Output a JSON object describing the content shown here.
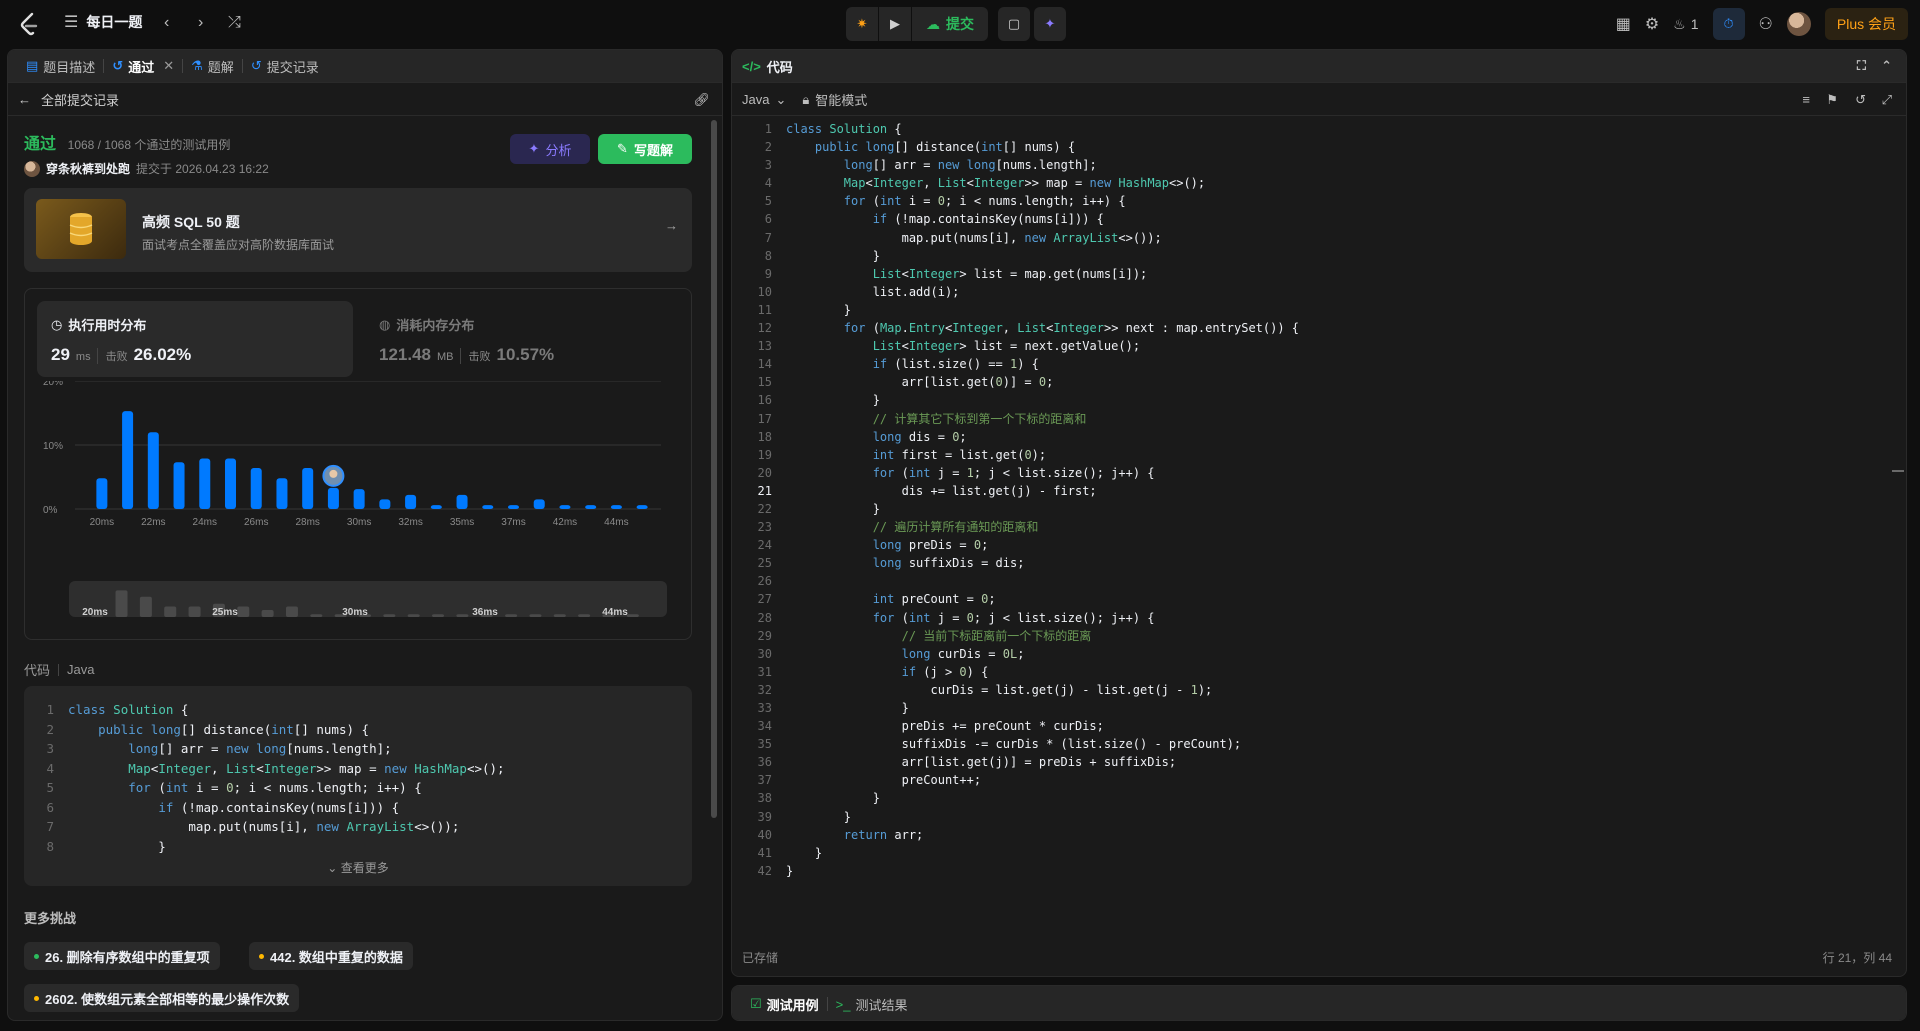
{
  "topbar": {
    "daily_label": "每日一题",
    "submit_label": "提交",
    "streak_count": "1",
    "plus_label": "Plus 会员"
  },
  "left": {
    "tabs": [
      {
        "label": "题目描述"
      },
      {
        "label": "通过"
      },
      {
        "label": "题解"
      },
      {
        "label": "提交记录"
      }
    ],
    "back_label": "全部提交记录",
    "status": "通过",
    "cases": "1068 / 1068 个通过的测试用例",
    "author": "穿条秋裤到处跑",
    "submitted": "提交于 2026.04.23 16:22",
    "analyze_label": "分析",
    "write_label": "写题解",
    "promo": {
      "title": "高频 SQL 50 题",
      "subtitle": "面试考点全覆盖应对高阶数据库面试"
    },
    "runtime": {
      "title": "执行用时分布",
      "value": "29",
      "unit": "ms",
      "beat_label": "击败",
      "beat": "26.02%"
    },
    "memory": {
      "title": "消耗内存分布",
      "value": "121.48",
      "unit": "MB",
      "beat_label": "击败",
      "beat": "10.57%"
    },
    "code_label": "代码",
    "code_lang": "Java",
    "see_more": "查看更多",
    "more_title": "更多挑战",
    "challenges": [
      {
        "label": "26. 删除有序数组中的重复项",
        "color": "#2cbb5d"
      },
      {
        "label": "442. 数组中重复的数据",
        "color": "#ffb800"
      },
      {
        "label": "2602. 使数组元素全部相等的最少操作次数",
        "color": "#ffb800"
      }
    ]
  },
  "chart_data": {
    "type": "bar",
    "title": "执行用时分布",
    "categories": [
      "20ms",
      "21ms",
      "22ms",
      "23ms",
      "24ms",
      "25ms",
      "26ms",
      "27ms",
      "28ms",
      "29ms",
      "30ms",
      "31ms",
      "32ms",
      "33ms",
      "35ms",
      "36ms",
      "37ms",
      "40ms",
      "42ms",
      "43ms",
      "44ms",
      "45ms"
    ],
    "values": [
      4.8,
      15.3,
      12.0,
      7.3,
      7.9,
      7.9,
      6.4,
      4.8,
      6.4,
      3.3,
      3.1,
      1.5,
      2.2,
      0.6,
      2.2,
      0.6,
      0.6,
      1.5,
      0.6,
      0.6,
      0.6,
      0.6
    ],
    "highlight_index": 9,
    "tick_labels": [
      "20ms",
      "22ms",
      "24ms",
      "26ms",
      "28ms",
      "30ms",
      "32ms",
      "35ms",
      "37ms",
      "42ms",
      "44ms"
    ],
    "yticks": [
      "20%",
      "10%",
      "0%"
    ],
    "ylim": [
      0,
      20
    ],
    "mini_values": [
      0.2,
      3.8,
      2.9,
      1.5,
      1.5,
      1.9,
      1.5,
      1.0,
      1.5,
      0.4,
      0.4,
      0.4,
      0.4,
      0.4,
      0.4,
      0.4,
      0.4,
      0.4,
      0.4,
      0.4,
      0.4,
      0.4,
      0.4
    ],
    "mini_tick_labels": [
      "20ms",
      "25ms",
      "30ms",
      "36ms",
      "44ms"
    ]
  },
  "editor": {
    "title": "代码",
    "language": "Java",
    "mode": "智能模式",
    "saved": "已存储",
    "cursor": "行 21，列 44",
    "current_line": 21
  },
  "bottom": {
    "tab_cases": "测试用例",
    "tab_results": "测试结果"
  },
  "code_lines": [
    "class Solution {",
    "    public long[] distance(int[] nums) {",
    "        long[] arr = new long[nums.length];",
    "        Map<Integer, List<Integer>> map = new HashMap<>();",
    "        for (int i = 0; i < nums.length; i++) {",
    "            if (!map.containsKey(nums[i])) {",
    "                map.put(nums[i], new ArrayList<>());",
    "            }",
    "            List<Integer> list = map.get(nums[i]);",
    "            list.add(i);",
    "        }",
    "        for (Map.Entry<Integer, List<Integer>> next : map.entrySet()) {",
    "            List<Integer> list = next.getValue();",
    "            if (list.size() == 1) {",
    "                arr[list.get(0)] = 0;",
    "            }",
    "            // 计算其它下标到第一个下标的距离和",
    "            long dis = 0;",
    "            int first = list.get(0);",
    "            for (int j = 1; j < list.size(); j++) {",
    "                dis += list.get(j) - first;",
    "            }",
    "            // 遍历计算所有通知的距离和",
    "            long preDis = 0;",
    "            long suffixDis = dis;",
    "",
    "            int preCount = 0;",
    "            for (int j = 0; j < list.size(); j++) {",
    "                // 当前下标距离前一个下标的距离",
    "                long curDis = 0L;",
    "                if (j > 0) {",
    "                    curDis = list.get(j) - list.get(j - 1);",
    "                }",
    "                preDis += preCount * curDis;",
    "                suffixDis -= curDis * (list.size() - preCount);",
    "                arr[list.get(j)] = preDis + suffixDis;",
    "                preCount++;",
    "            }",
    "        }",
    "        return arr;",
    "    }",
    "}"
  ],
  "preview_lines": [
    "class Solution {",
    "    public long[] distance(int[] nums) {",
    "        long[] arr = new long[nums.length];",
    "        Map<Integer, List<Integer>> map = new HashMap<>();",
    "        for (int i = 0; i < nums.length; i++) {",
    "            if (!map.containsKey(nums[i])) {",
    "                map.put(nums[i], new ArrayList<>());",
    "            }"
  ]
}
